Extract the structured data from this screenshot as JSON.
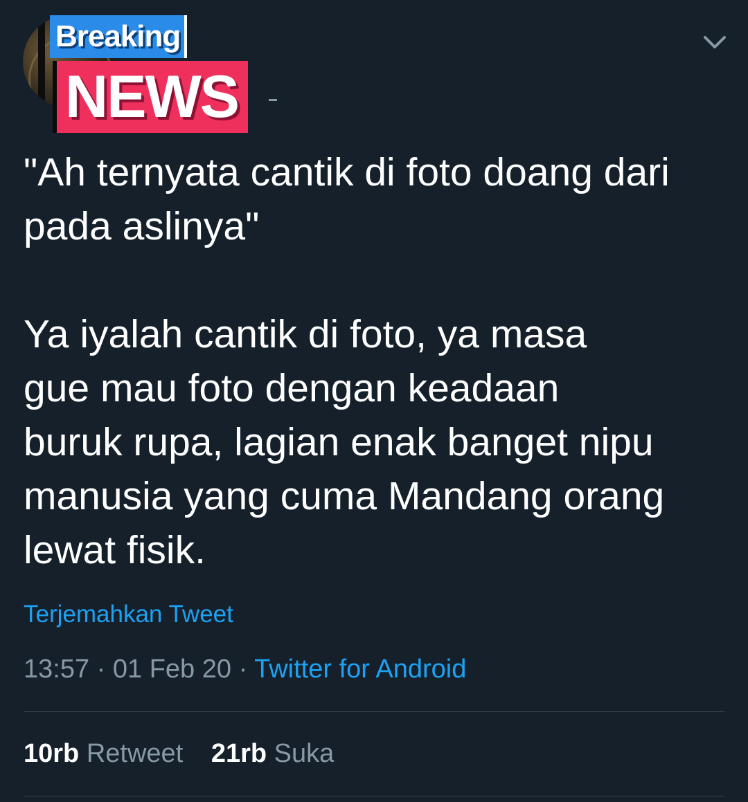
{
  "avatar": {
    "overlay_line1": "Breaking",
    "overlay_line2": "NEWS"
  },
  "header": {
    "menu_icon": "chevron-down-icon"
  },
  "tweet": {
    "text": "\"Ah ternyata cantik di foto doang dari\npada aslinya\"\n\nYa iyalah cantik di foto, ya masa\ngue mau foto dengan keadaan\nburuk rupa, lagian enak banget nipu\nmanusia yang cuma Mandang orang\nlewat fisik.",
    "translate_label": "Terjemahkan Tweet",
    "time": "13:57",
    "date": "01 Feb 20",
    "separator": " · ",
    "source": "Twitter for Android"
  },
  "stats": {
    "retweets_count": "10rb",
    "retweets_label": "Retweet",
    "likes_count": "21rb",
    "likes_label": "Suka"
  },
  "colors": {
    "background": "#15202b",
    "text": "#ffffff",
    "muted": "#8899a6",
    "link": "#1da1f2",
    "divider": "#38444d",
    "breaking_bg": "#2a8be8",
    "news_bg": "#ef2f5c"
  }
}
